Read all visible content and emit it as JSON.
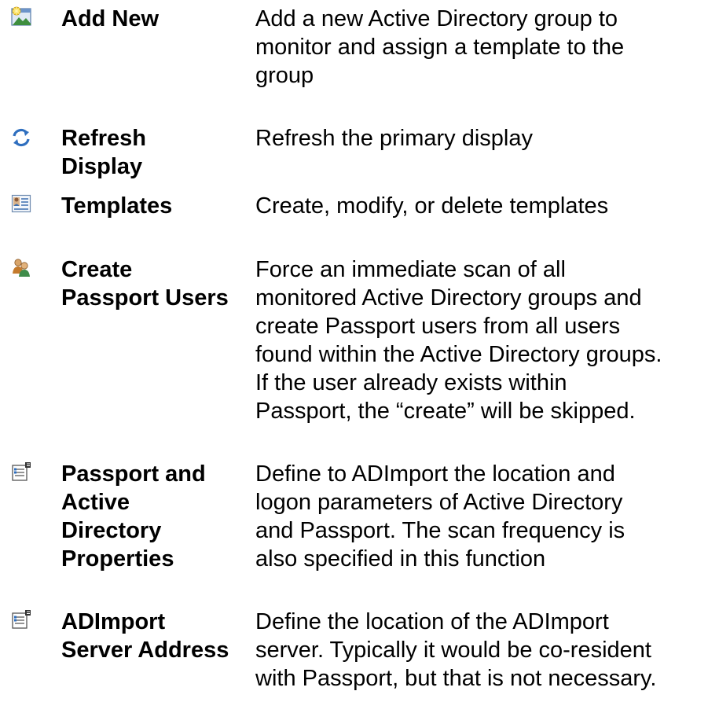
{
  "commands": [
    {
      "icon": "add-new-icon",
      "label_lines": [
        "Add New"
      ],
      "desc_lines": [
        "Add a new Active Directory group to",
        "monitor and assign a template to the",
        "group"
      ]
    },
    {
      "icon": "refresh-icon",
      "label_lines": [
        "Refresh",
        "Display"
      ],
      "desc_lines": [
        "Refresh the primary display"
      ]
    },
    {
      "icon": "templates-icon",
      "label_lines": [
        "Templates"
      ],
      "desc_lines": [
        "Create, modify, or delete templates"
      ]
    },
    {
      "icon": "users-icon",
      "label_lines": [
        "Create",
        "Passport Users"
      ],
      "desc_lines": [
        "Force an immediate scan of all",
        "monitored Active Directory groups and",
        "create Passport users from all users",
        "found within the Active Directory groups.",
        "If the user already exists within",
        "Passport, the “create” will be skipped."
      ]
    },
    {
      "icon": "properties-icon",
      "label_lines": [
        "Passport and",
        "Active",
        "Directory",
        "Properties"
      ],
      "desc_lines": [
        "Define to ADImport the location and",
        "logon parameters of Active Directory",
        "and Passport. The scan frequency is",
        "also specified in this function"
      ]
    },
    {
      "icon": "properties-icon",
      "label_lines": [
        "ADImport",
        "Server Address"
      ],
      "desc_lines": [
        "Define the location of the ADImport",
        "server. Typically it would be co-resident",
        "with Passport, but that is not necessary."
      ]
    }
  ]
}
